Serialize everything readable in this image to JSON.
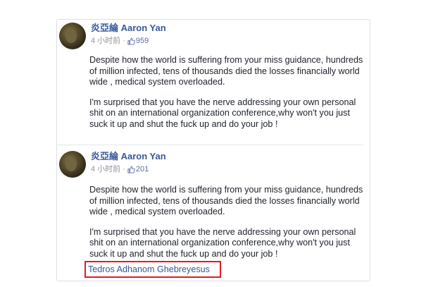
{
  "posts": [
    {
      "author": "炎亞綸 Aaron Yan",
      "time": "4 小时前",
      "separator": "·",
      "likes": "959",
      "paragraphs": [
        "Despite how the world is suffering from your miss guidance, hundreds of million infected, tens of thousands died the losses financially world wide , medical system overloaded.",
        "I'm surprised that you have the nerve addressing your own personal shit on an international organization conference,why won't you just suck it up and shut the fuck up and do your job !"
      ]
    },
    {
      "author": "炎亞綸 Aaron Yan",
      "time": "4 小时前",
      "separator": "·",
      "likes": "201",
      "paragraphs": [
        "Despite how the world is suffering from your miss guidance, hundreds of million infected, tens of thousands died the losses financially world wide , medical system overloaded.",
        "I'm surprised that you have the nerve addressing your own personal shit on an international organization conference,why won't you just suck it up and shut the fuck up and do your job !"
      ],
      "tagged_link": "Tedros Adhanom Ghebreyesus"
    }
  ],
  "icons": {
    "avatar": "avatar",
    "like": "thumbs-up-icon"
  },
  "colors": {
    "author": "#365899",
    "meta": "#90949c",
    "highlight_box": "#e21b1b"
  }
}
